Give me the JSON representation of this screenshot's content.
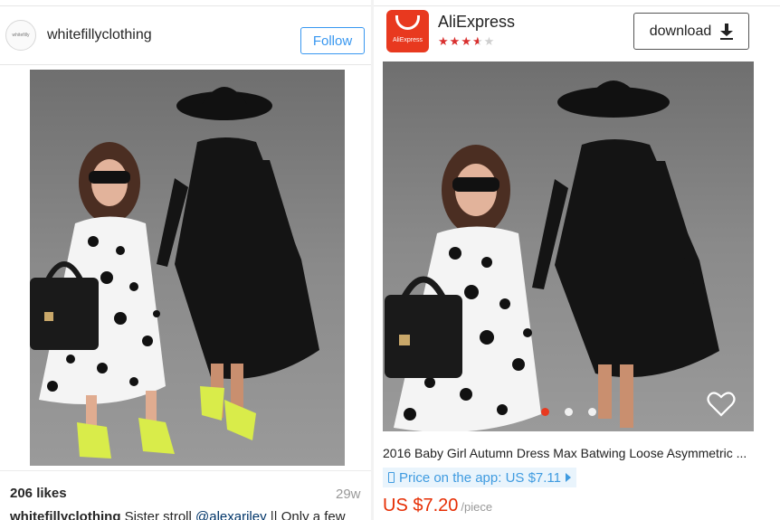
{
  "instagram": {
    "avatar_text": "whitefilly",
    "username": "whitefillyclothing",
    "follow_label": "Follow",
    "likes": "206 likes",
    "time_ago": "29w",
    "caption": {
      "user": "whitefillyclothing",
      "text": " Sister stroll ",
      "mention": "@alexariley",
      "rest": " || Only a few"
    }
  },
  "aliexpress": {
    "app_name": "AliExpress",
    "logo_text": "AliExpress",
    "rating_stars": 3.5,
    "download_label": "download",
    "download_icon": "download-icon",
    "product_title": "2016 Baby Girl Autumn Dress Max Batwing Loose Asymmetric ...",
    "app_price": "Price on the app: US $7.11",
    "price": "US $7.20",
    "price_unit": "/piece",
    "carousel_dots": 3,
    "carousel_active": 0
  },
  "colors": {
    "instagram_blue": "#3897f0",
    "aliexpress_red": "#e8391f",
    "price_red": "#e62e04",
    "app_price_blue": "#3f9be0"
  }
}
